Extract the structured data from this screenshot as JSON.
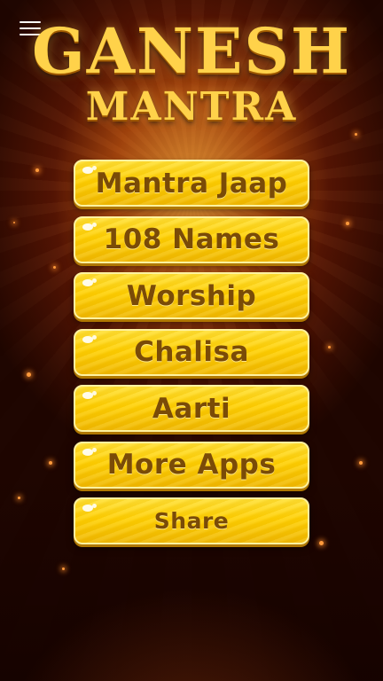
{
  "app": {
    "title_line1": "GANESH",
    "title_line2": "MANTRA",
    "icons": {
      "menu": "hamburger-menu-icon"
    },
    "colors": {
      "title": "#ffd24a",
      "button": "#ffd000",
      "button_text": "#7a4b07"
    }
  },
  "menu": {
    "buttons": [
      {
        "label": "Mantra Jaap"
      },
      {
        "label": "108 Names"
      },
      {
        "label": "Worship"
      },
      {
        "label": "Chalisa"
      },
      {
        "label": "Aarti"
      },
      {
        "label": "More Apps"
      },
      {
        "label": "Share"
      }
    ]
  }
}
